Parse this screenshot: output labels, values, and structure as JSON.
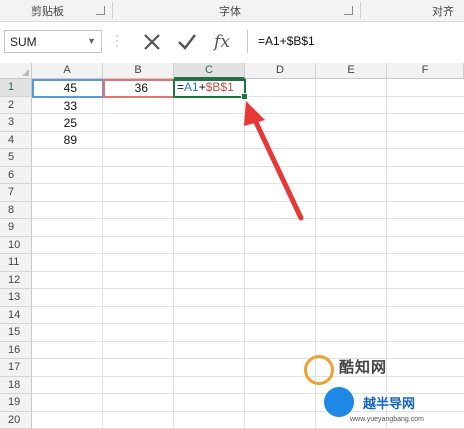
{
  "ribbon": {
    "groups": [
      {
        "label": "剪贴板"
      },
      {
        "label": "字体"
      },
      {
        "label": "对齐"
      }
    ]
  },
  "formula_bar": {
    "name_box": "SUM",
    "cancel_icon": "close-x-icon",
    "enter_icon": "checkmark-icon",
    "fx_label": "fx",
    "formula": "=A1+$B$1"
  },
  "sheet": {
    "columns": [
      "A",
      "B",
      "C",
      "D",
      "E",
      "F"
    ],
    "active_column": "C",
    "rows": [
      "1",
      "2",
      "3",
      "4",
      "5",
      "6",
      "7",
      "8",
      "9",
      "10",
      "11",
      "12",
      "13",
      "14",
      "15",
      "16",
      "17",
      "18",
      "19",
      "20"
    ],
    "active_row": "1",
    "cells": {
      "A1": "45",
      "A2": "33",
      "A3": "25",
      "A4": "89",
      "B1": "36"
    },
    "editing_cell": {
      "ref": "C1",
      "eq": "=",
      "part_a": "A1",
      "plus": "+",
      "part_b": "$B$1"
    }
  },
  "annotation": {
    "type": "arrow",
    "color": "#e53935"
  },
  "watermark": {
    "line1": "酷知网",
    "line2": "越半导网",
    "line3": "www.yueyangbang.com"
  },
  "colors": {
    "accent": "#217346",
    "ref_a": "#2e75b6",
    "ref_b": "#c0504d"
  }
}
